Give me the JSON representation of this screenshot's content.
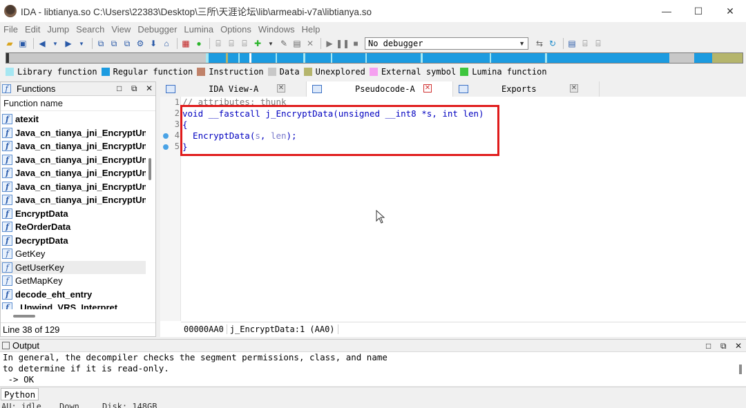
{
  "window": {
    "title": "IDA - libtianya.so C:\\Users\\22383\\Desktop\\三所\\天涯论坛\\lib\\armeabi-v7a\\libtianya.so",
    "minimize": "—",
    "maximize": "☐",
    "close": "✕"
  },
  "menu": [
    "File",
    "Edit",
    "Jump",
    "Search",
    "View",
    "Debugger",
    "Lumina",
    "Options",
    "Windows",
    "Help"
  ],
  "toolbar": {
    "debugger": "No debugger"
  },
  "legend": [
    {
      "label": "Library function",
      "color": "#a6e7f2"
    },
    {
      "label": "Regular function",
      "color": "#1c9be0"
    },
    {
      "label": "Instruction",
      "color": "#c0826a"
    },
    {
      "label": "Data",
      "color": "#c8c8c8"
    },
    {
      "label": "Unexplored",
      "color": "#b5b56c"
    },
    {
      "label": "External symbol",
      "color": "#f5a0f0"
    },
    {
      "label": "Lumina function",
      "color": "#3ec63e"
    }
  ],
  "functions_panel": {
    "title": "Functions",
    "column": "Function name",
    "items": [
      {
        "name": "atexit",
        "bold": true
      },
      {
        "name": "Java_cn_tianya_jni_EncryptUni",
        "bold": true
      },
      {
        "name": "Java_cn_tianya_jni_EncryptUni",
        "bold": true
      },
      {
        "name": "Java_cn_tianya_jni_EncryptUni",
        "bold": true
      },
      {
        "name": "Java_cn_tianya_jni_EncryptUni",
        "bold": true
      },
      {
        "name": "Java_cn_tianya_jni_EncryptUni",
        "bold": true
      },
      {
        "name": "Java_cn_tianya_jni_EncryptUni",
        "bold": true
      },
      {
        "name": "EncryptData",
        "bold": true
      },
      {
        "name": "ReOrderData",
        "bold": true
      },
      {
        "name": "DecryptData",
        "bold": true
      },
      {
        "name": "GetKey",
        "bold": false
      },
      {
        "name": "GetUserKey",
        "bold": false
      },
      {
        "name": "GetMapKey",
        "bold": false
      },
      {
        "name": "decode_eht_entry",
        "bold": true
      },
      {
        "name": "_Unwind_VRS_Interpret",
        "bold": true
      }
    ],
    "status": "Line 38 of 129"
  },
  "tabs": [
    {
      "label": "IDA View-A"
    },
    {
      "label": "Pseudocode-A"
    },
    {
      "label": "Exports"
    }
  ],
  "pseudocode": {
    "line_numbers": [
      "1",
      "2",
      "3",
      "4",
      "5"
    ],
    "comment": "// attributes: thunk",
    "sig_void": "void",
    "sig_fastcall": " __fastcall j_EncryptData(",
    "sig_unsigned": "unsigned",
    "sig_int8": " __int8 *",
    "sig_s": "s",
    "sig_comma": ", ",
    "sig_int": "int",
    "sig_len": " len",
    "sig_close": ")",
    "open_brace": "{",
    "call_name": "  EncryptData(",
    "call_s": "s",
    "call_comma": ", ",
    "call_len": "len",
    "call_end": ");",
    "close_brace": "}",
    "status_addr": "00000AA0",
    "status_func": "j_EncryptData:1 (AA0)"
  },
  "output_panel": {
    "title": "Output",
    "lines": [
      "In general, the decompiler checks the segment permissions, class, and name",
      "to determine if it is read-only.",
      " -> OK"
    ]
  },
  "python_button": "Python",
  "statusbar": {
    "mode": "AU:  idle",
    "direction": "Down",
    "disk": "Disk: 148GB"
  }
}
